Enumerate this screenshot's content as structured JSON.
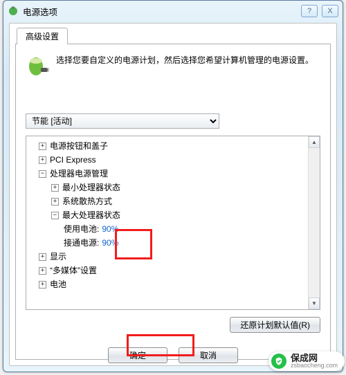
{
  "window": {
    "title": "电源选项",
    "help_tip": "?",
    "close_tip": "X"
  },
  "tabs": {
    "advanced": "高级设置"
  },
  "intro": "选择您要自定义的电源计划，然后选择您希望计算机管理的电源设置。",
  "plan": {
    "selected": "节能 [活动]"
  },
  "tree": {
    "power_btn_lid": "电源按钮和盖子",
    "pci_express": "PCI Express",
    "proc_mgmt": "处理器电源管理",
    "min_proc": "最小处理器状态",
    "cooling": "系统散热方式",
    "max_proc": "最大处理器状态",
    "on_battery_lbl": "使用电池:",
    "on_battery_val": "90%",
    "on_ac_lbl": "接通电源:",
    "on_ac_val": "90%",
    "display": "显示",
    "multimedia": "“多媒体”设置",
    "battery": "电池"
  },
  "buttons": {
    "restore": "还原计划默认值(R)",
    "ok": "确定",
    "cancel": "取消"
  },
  "watermark": {
    "name": "保成网",
    "url": "zsbaocheng.com"
  }
}
